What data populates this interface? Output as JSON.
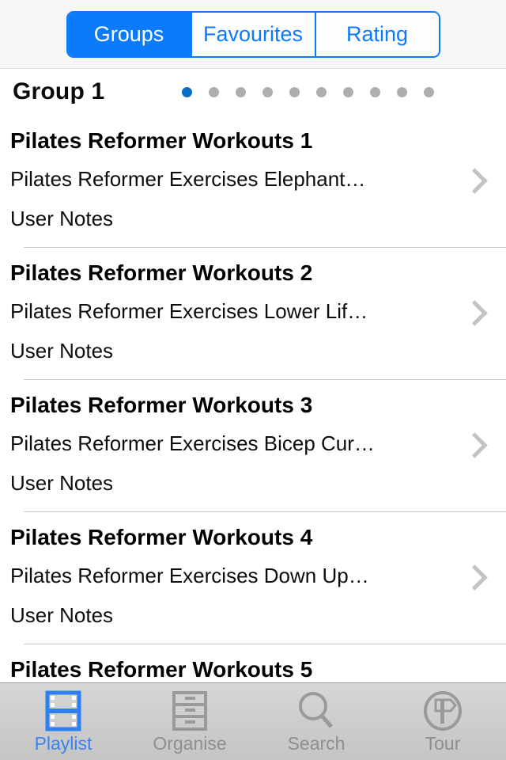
{
  "segmented_control": {
    "options": [
      {
        "label": "Groups",
        "selected": true
      },
      {
        "label": "Favourites",
        "selected": false
      },
      {
        "label": "Rating",
        "selected": false
      }
    ],
    "accent_color": "#0b7bfb"
  },
  "group_header": {
    "title": "Group 1",
    "page_dots": {
      "count": 10,
      "active_index": 0,
      "active_color": "#0b6ec4",
      "inactive_color": "#aeaeae"
    }
  },
  "list": {
    "rows": [
      {
        "title": "Pilates Reformer Workouts 1",
        "subtitle": "Pilates Reformer Exercises  Elephant…",
        "notes": "User Notes",
        "accessory": "chevron-right"
      },
      {
        "title": "Pilates Reformer Workouts 2",
        "subtitle": "Pilates Reformer Exercises  Lower  Lif…",
        "notes": "User Notes",
        "accessory": "chevron-right"
      },
      {
        "title": "Pilates Reformer Workouts 3",
        "subtitle": "Pilates Reformer Exercises  Bicep Cur…",
        "notes": "User Notes",
        "accessory": "chevron-right"
      },
      {
        "title": "Pilates Reformer Workouts 4",
        "subtitle": "Pilates Reformer Exercises  Down  Up…",
        "notes": "User Notes",
        "accessory": "chevron-right"
      },
      {
        "title": "Pilates Reformer Workouts 5",
        "subtitle": "",
        "notes": "",
        "accessory": ""
      }
    ]
  },
  "tabbar": {
    "tabs": [
      {
        "label": "Playlist",
        "icon": "film-strip-icon",
        "selected": true
      },
      {
        "label": "Organise",
        "icon": "file-cabinet-icon",
        "selected": false
      },
      {
        "label": "Search",
        "icon": "magnifier-icon",
        "selected": false
      },
      {
        "label": "Tour",
        "icon": "signpost-icon",
        "selected": false
      }
    ],
    "selected_color": "#3b83f0",
    "unselected_color": "#8e8e93"
  }
}
